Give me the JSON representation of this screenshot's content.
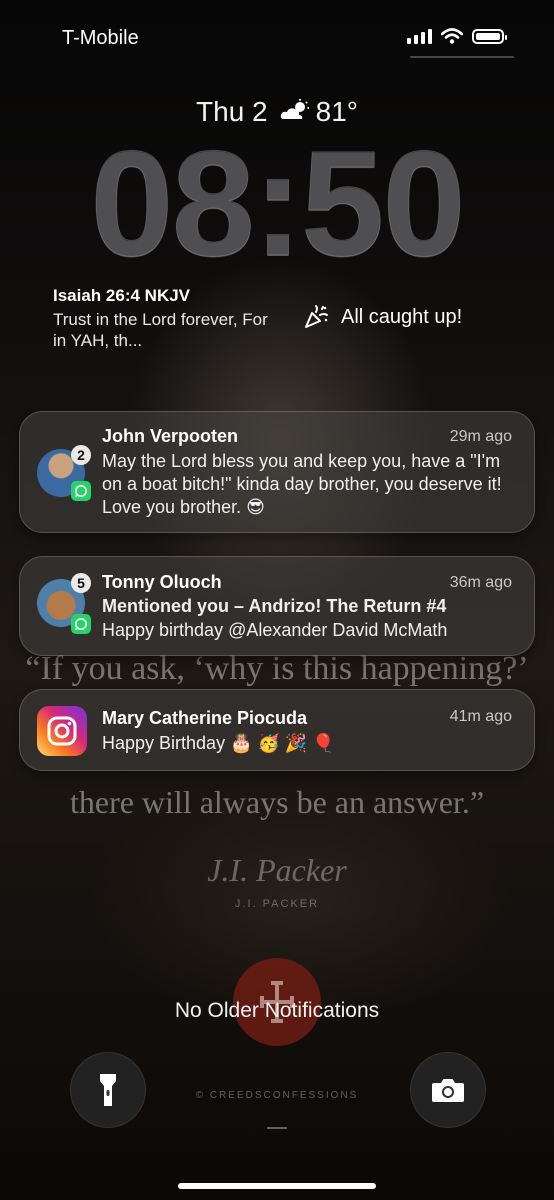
{
  "status": {
    "carrier": "T-Mobile"
  },
  "lockscreen": {
    "date": "Thu 2",
    "weather": "81°",
    "time": "08:50",
    "verse_title": "Isaiah 26:4 NKJV",
    "verse_text": "Trust in the Lord forever, For in YAH, th...",
    "caught_up": "All caught up!"
  },
  "notifications": [
    {
      "sender": "John Verpooten",
      "time": "29m ago",
      "badge": "2",
      "app": "WhatsApp",
      "body": "May the Lord bless you and keep you, have a \"I'm on a boat bitch!\" kinda day brother, you deserve it! Love you brother. 😎"
    },
    {
      "sender": "Tonny Oluoch",
      "time": "36m ago",
      "badge": "5",
      "app": "WhatsApp",
      "subtitle": "Mentioned you – Andrizo! The Return #4",
      "body": "Happy birthday @Alexander David McMath"
    },
    {
      "sender": "Mary Catherine Piocuda",
      "time": "41m ago",
      "app": "Instagram",
      "body": "Happy Birthday 🎂 🥳 🎉 🎈"
    }
  ],
  "wallpaper": {
    "quote_line1": "“If you ask, ‘why is this happening?’",
    "quote_line3": "there will always be an answer.”",
    "author_signature": "J.I. Packer",
    "author": "J.I. PACKER",
    "credit": "© CREEDSCONFESSIONS"
  },
  "footer": {
    "no_older": "No Older Notifications"
  },
  "colors": {
    "whatsapp": "#25d366",
    "instagram_start": "#feda75",
    "instagram_end": "#962fbf"
  }
}
